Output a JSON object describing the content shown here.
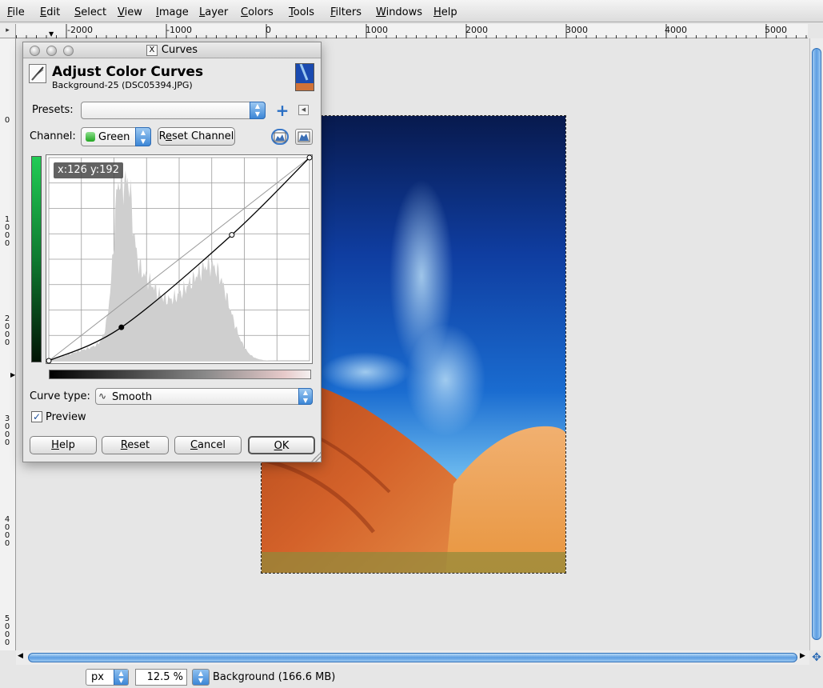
{
  "menubar": {
    "items": [
      "File",
      "Edit",
      "Select",
      "View",
      "Image",
      "Layer",
      "Colors",
      "Tools",
      "Filters",
      "Windows",
      "Help"
    ]
  },
  "ruler": {
    "h_labels": [
      "-2000",
      "-1000",
      "0",
      "1000",
      "2000",
      "3000",
      "4000",
      "5000"
    ],
    "v_labels": [
      "0",
      "1000",
      "2000",
      "3000",
      "4000",
      "5000"
    ]
  },
  "dialog": {
    "window_title": "Curves",
    "header_title": "Adjust Color Curves",
    "header_subtitle": "Background-25 (DSC05394.JPG)",
    "presets_label": "Presets:",
    "presets_value": "",
    "channel_label": "Channel:",
    "channel_value": "Green",
    "reset_channel_label": "Reset Channel",
    "coord_readout": "x:126 y:192",
    "curve_type_label": "Curve type:",
    "curve_type_value": "Smooth",
    "preview_label": "Preview",
    "preview_checked": true,
    "buttons": {
      "help": "Help",
      "reset": "Reset",
      "cancel": "Cancel",
      "ok": "OK"
    },
    "curve_points": [
      [
        0,
        0
      ],
      [
        71,
        42
      ],
      [
        179,
        158
      ],
      [
        255,
        255
      ]
    ]
  },
  "status": {
    "unit": "px",
    "zoom": "12.5 %",
    "layer_info": "Background (166.6 MB)"
  },
  "colors": {
    "accent_blue": "#3c86d6",
    "channel_green": "#21a621"
  }
}
